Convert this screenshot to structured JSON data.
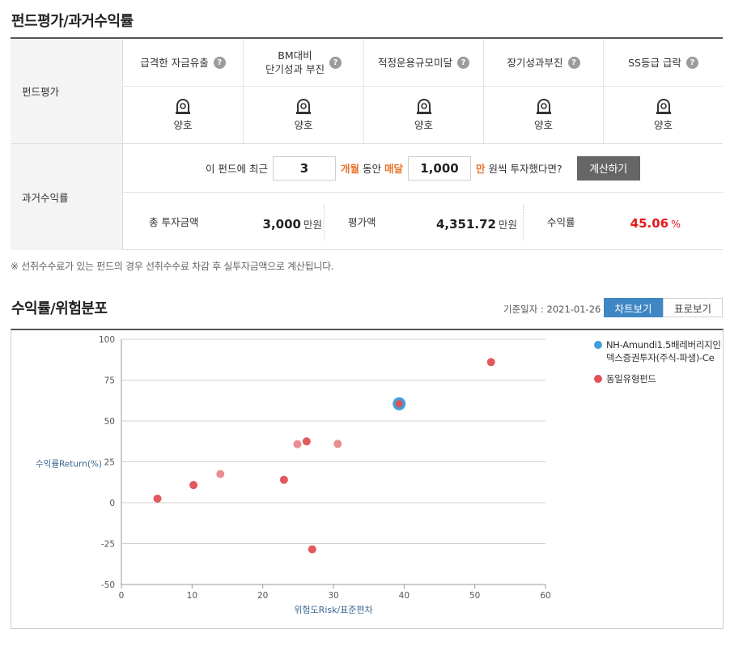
{
  "sections": {
    "fund_eval_title": "펀드평가/과거수익률",
    "chart_title": "수익률/위험분포"
  },
  "fund_eval": {
    "row_label": "펀드평가",
    "columns": [
      {
        "line1": "급격한 자금유출",
        "line2": "",
        "value": "양호"
      },
      {
        "line1": "BM대비",
        "line2": "단기성과 부진",
        "value": "양호"
      },
      {
        "line1": "적정운용규모미달",
        "line2": "",
        "value": "양호"
      },
      {
        "line1": "장기성과부진",
        "line2": "",
        "value": "양호"
      },
      {
        "line1": "SS등급 급락",
        "line2": "",
        "value": "양호"
      }
    ],
    "help_glyph": "?",
    "icon": "lamp-icon"
  },
  "past_return": {
    "row_label": "과거수익률",
    "prefix": "이 펀드에 최근",
    "months_value": "3",
    "months_label": "개월",
    "middle": "동안",
    "monthly_label": "매달",
    "amount_value": "1,000",
    "amount_unit": "만",
    "suffix": "원씩 투자했다면?",
    "calc_button": "계산하기",
    "total_label": "총 투자금액",
    "total_value": "3,000",
    "total_unit": "만원",
    "eval_label": "평가액",
    "eval_value": "4,351.72",
    "eval_unit": "만원",
    "return_label": "수익률",
    "return_value": "45.06",
    "return_unit": "%"
  },
  "note": "※ 선취수수료가 있는 펀드의 경우 선취수수료 차감 후 실투자금액으로 계산됩니다.",
  "chart_header": {
    "base_date": "기준일자 : 2021-01-26",
    "tab_chart": "차트보기",
    "tab_table": "표로보기"
  },
  "chart_data": {
    "type": "scatter",
    "xlabel": "위험도Risk/표준편차",
    "ylabel": "수익률Return(%)",
    "xlim": [
      0,
      60
    ],
    "ylim": [
      -50,
      100
    ],
    "xticks": [
      0,
      10,
      20,
      30,
      40,
      50,
      60
    ],
    "yticks": [
      100,
      75,
      50,
      25,
      0,
      -25,
      -50
    ],
    "grid": "horizontal",
    "legend_position": "top-right",
    "series": [
      {
        "name": "NH-Amundi1.5배레버리지인\n덱스증권투자(주식-파생)-Ce",
        "legend_line1": "NH-Amundi1.5배레버리지인",
        "legend_line2": "덱스증권투자(주식-파생)-Ce",
        "color": "#41a0dc",
        "points": [
          [
            39.3,
            60.5
          ]
        ]
      },
      {
        "name": "동일유형펀드",
        "legend_line1": "동일유형펀드",
        "legend_line2": "",
        "color": "#e05055",
        "points": [
          [
            5.1,
            2.5
          ],
          [
            10.2,
            10.8
          ],
          [
            14.0,
            17.5
          ],
          [
            23.0,
            14.0
          ],
          [
            24.9,
            35.8
          ],
          [
            26.2,
            37.5
          ],
          [
            30.6,
            36.0
          ],
          [
            27.0,
            -28.5
          ],
          [
            39.3,
            60.5
          ],
          [
            52.3,
            86.0
          ]
        ]
      }
    ]
  }
}
